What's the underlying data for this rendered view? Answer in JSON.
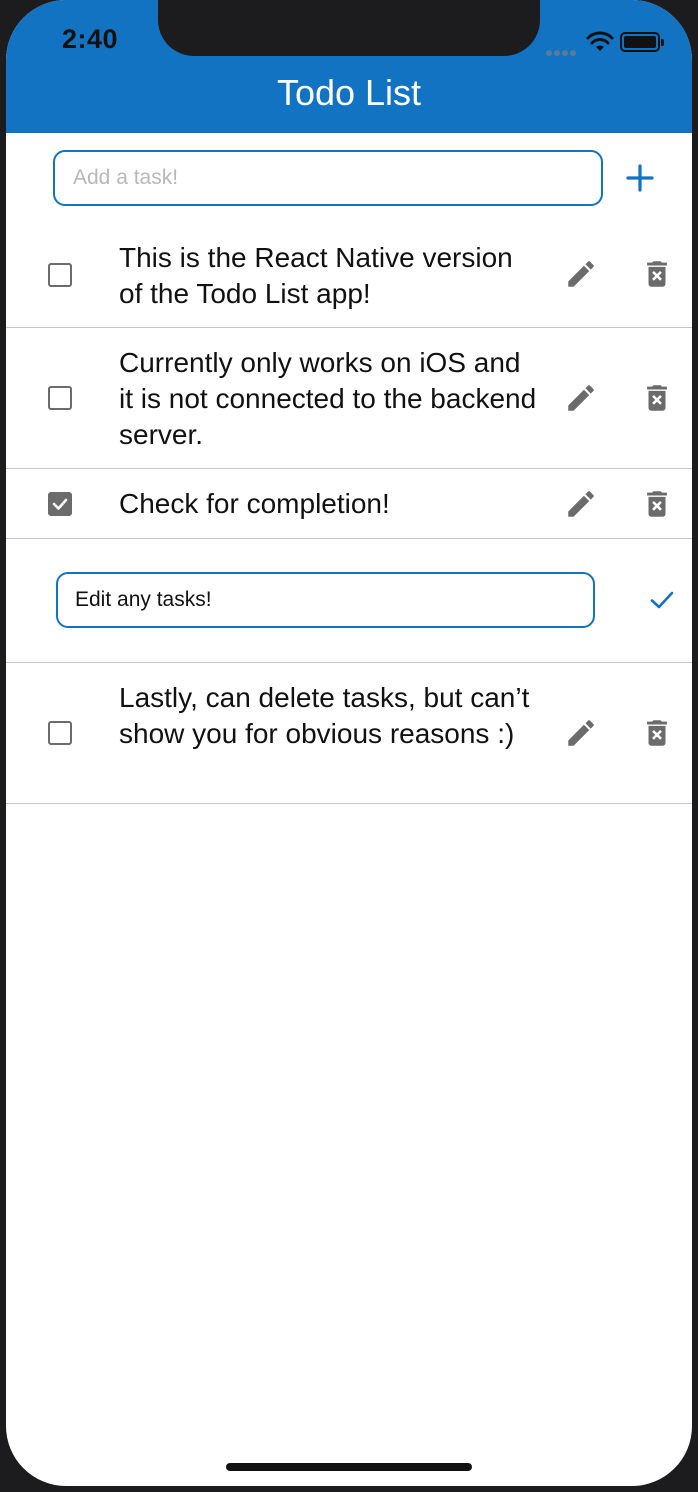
{
  "status_bar": {
    "time": "2:40"
  },
  "header": {
    "title": "Todo List"
  },
  "add_task": {
    "placeholder": "Add a task!",
    "value": ""
  },
  "tasks": [
    {
      "text": "This is the React Native version of the Todo List app!",
      "checked": false
    },
    {
      "text": "Currently only works on iOS and it is not connected to the backend server.",
      "checked": false
    },
    {
      "text": "Check for completion!",
      "checked": true
    },
    {
      "text": "Lastly, can delete tasks, but can’t show you for obvious reasons :)",
      "checked": false
    }
  ],
  "editing_task": {
    "value": "Edit any tasks!"
  },
  "colors": {
    "accent": "#1273c2",
    "icon_gray": "#6b6b6b",
    "divider": "#c6c6c6"
  },
  "icons": {
    "add": "plus-icon",
    "edit": "pencil-icon",
    "delete": "trash-icon",
    "confirm": "check-icon",
    "checkbox": "checkbox-icon"
  }
}
